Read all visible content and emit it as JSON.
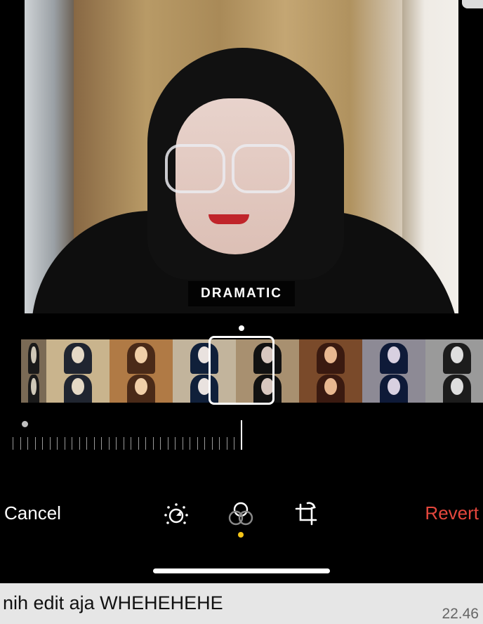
{
  "photo": {
    "filter_name": "DRAMATIC"
  },
  "filters": [
    {
      "hijab": "#1a1a1a",
      "face": "#cfc8b8",
      "bg": "#7a6a55"
    },
    {
      "hijab": "#202530",
      "face": "#e5d9c6",
      "bg": "#c9b48d"
    },
    {
      "hijab": "#4a2a18",
      "face": "#f0cfa8",
      "bg": "#b07a45"
    },
    {
      "hijab": "#10203a",
      "face": "#e9e2df",
      "bg": "#c2b49c"
    },
    {
      "hijab": "#111111",
      "face": "#d8c8c0",
      "bg": "#a89070"
    },
    {
      "hijab": "#3a1a10",
      "face": "#e8b890",
      "bg": "#7a4a2a"
    },
    {
      "hijab": "#0e1a38",
      "face": "#d8d0e0",
      "bg": "#8d8a95"
    },
    {
      "hijab": "#1c1c1c",
      "face": "#dedede",
      "bg": "#9a9a9a"
    },
    {
      "hijab": "#050505",
      "face": "#b8b8b8",
      "bg": "#555555"
    }
  ],
  "toolbar": {
    "cancel_label": "Cancel",
    "revert_label": "Revert",
    "active_tool": "filters"
  },
  "icons": {
    "adjust": "adjust-dial-icon",
    "filters": "filters-icon",
    "crop": "crop-rotate-icon"
  },
  "colors": {
    "revert": "#e5473d",
    "active_dot": "#f5c518"
  },
  "message": {
    "text": "nih edit aja WHEHEHEHE",
    "time": "22.46"
  }
}
